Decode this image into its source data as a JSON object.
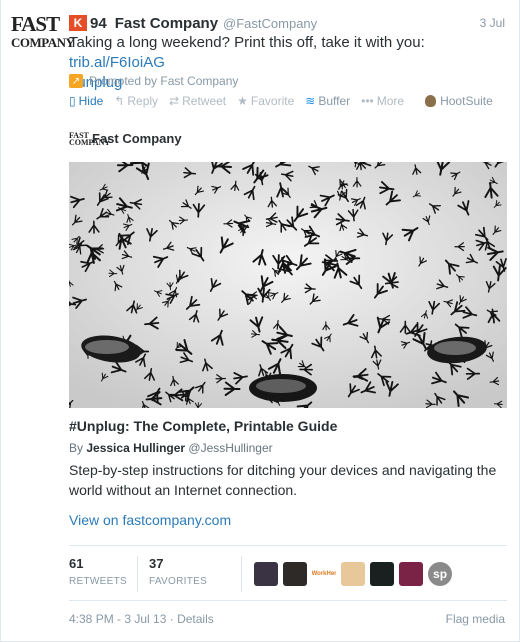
{
  "account": {
    "logo_line1": "FAST",
    "logo_line2": "COMPANY",
    "name": "Fast Company",
    "handle": "@FastCompany",
    "klout_icon": "K",
    "klout_score": "94"
  },
  "tweet": {
    "date": "3 Jul",
    "text": "Taking a long weekend? Print this off, take it with you: ",
    "link": "trib.al/F6IoiAG",
    "hashtag": "#unplug",
    "promoted_label": "Promoted by Fast Company"
  },
  "actions": [
    {
      "label": "Hide",
      "icon": "hide-icon"
    },
    {
      "label": "Reply",
      "icon": "reply-icon"
    },
    {
      "label": "Retweet",
      "icon": "retweet-icon"
    },
    {
      "label": "Favorite",
      "icon": "star-icon"
    },
    {
      "label": "Buffer",
      "icon": "buffer-icon"
    },
    {
      "label": "More",
      "icon": "more-icon"
    },
    {
      "label": "HootSuite",
      "icon": "hootsuite-icon"
    }
  ],
  "card": {
    "source_logo": "FAST COMPANY",
    "source_name": "Fast Company",
    "title": "#Unplug: The Complete, Printable Guide",
    "byline_prefix": "By",
    "author": "Jessica Hullinger",
    "author_handle": "@JessHullinger",
    "description": "Step-by-step instructions for ditching your devices and navigating the world without an Internet connection.",
    "view_link": "View on fastcompany.com"
  },
  "stats": {
    "retweets": "61",
    "retweets_label": "RETWEETS",
    "favorites": "37",
    "favorites_label": "FAVORITES",
    "avatar_colors": [
      "#3a3344",
      "#2e2a28",
      "#ffffff",
      "#e8c89a",
      "#1a1f20",
      "#7a2347",
      "#8a8a8a"
    ],
    "avatar_texts": [
      "",
      "",
      "WorkHer",
      "",
      "",
      "",
      "sp"
    ]
  },
  "footer": {
    "timestamp": "4:38 PM - 3 Jul 13",
    "separator": "·",
    "details": "Details",
    "flag_media": "Flag media"
  },
  "colors": {
    "link": "#2b7bb9",
    "klout": "#e44d26",
    "promoted": "#f5a623",
    "buffer": "#168eea"
  }
}
